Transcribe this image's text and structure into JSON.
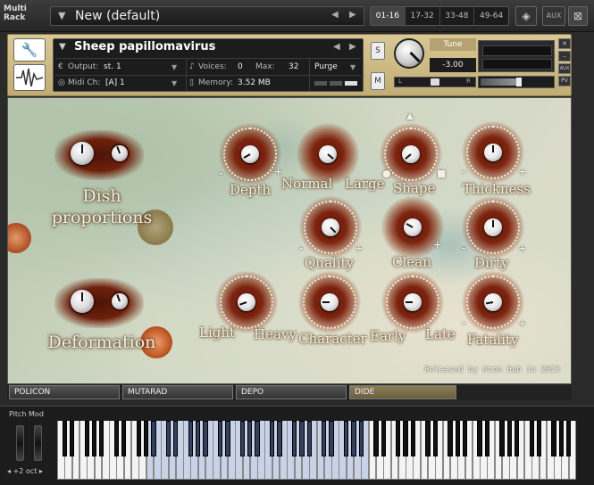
{
  "rack": {
    "label_line1": "Multi",
    "label_line2": "Rack",
    "preset_name": "New (default)",
    "pages": [
      "01-16",
      "17-32",
      "33-48",
      "49-64"
    ],
    "active_page": 0,
    "aux_label": "AUX"
  },
  "instrument": {
    "name": "Sheep papillomavirus",
    "output_label": "Output:",
    "output_value": "st. 1",
    "voices_label": "Voices:",
    "voices_value": "0",
    "max_label": "Max:",
    "max_value": "32",
    "purge_label": "Purge",
    "midi_label": "Midi Ch:",
    "midi_value": "[A]  1",
    "memory_label": "Memory:",
    "memory_value": "3.52 MB",
    "solo_label": "S",
    "mute_label": "M",
    "tune_label": "Tune",
    "tune_value": "-3.00",
    "pan_left": "L",
    "pan_right": "R",
    "aux_label": "AUX",
    "pv_label": "PV"
  },
  "panel": {
    "dish_label_1": "Dish",
    "dish_label_2": "proportions",
    "deformation_label": "Deformation",
    "knobs": {
      "depth": "Depth",
      "normal": "Normal",
      "large": "Large",
      "shape": "Shape",
      "thickness": "Thickness",
      "quality": "Quality",
      "clean": "Clean",
      "dirty": "Dirty",
      "light": "Light",
      "heavy": "Heavy",
      "character": "Character",
      "early": "Early",
      "late": "Late",
      "fatality": "Fatality"
    },
    "credit": "Released by Atom Hub in 2013"
  },
  "tabs": [
    "POLICON",
    "MUTARAD",
    "DEPO",
    "DIDE"
  ],
  "active_tab": 3,
  "keyboard": {
    "pitch_mod_label": "Pitch Mod",
    "octave_label": "+2 oct"
  },
  "colors": {
    "panel_tan": "#c9b57f",
    "knob_glow": "#7d2410",
    "highlight_keys": "#c9d3e8"
  }
}
